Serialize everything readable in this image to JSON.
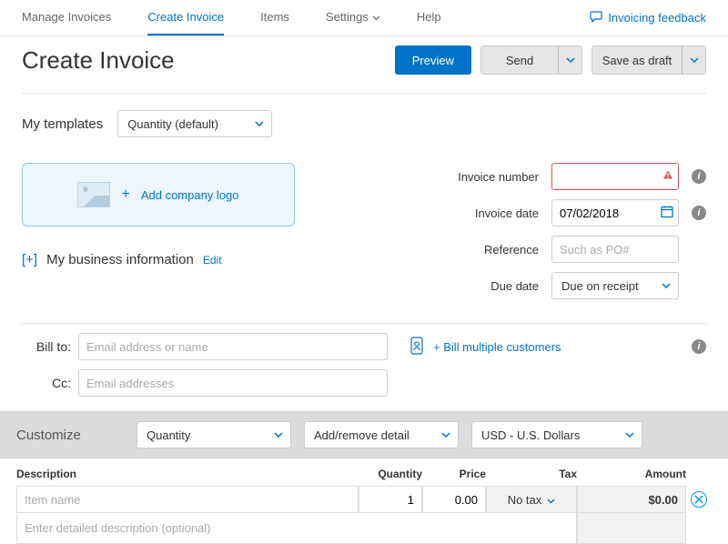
{
  "topnav": {
    "tabs": [
      "Manage Invoices",
      "Create Invoice",
      "Items",
      "Settings",
      "Help"
    ],
    "active_index": 1,
    "feedback_label": "Invoicing feedback"
  },
  "header": {
    "title": "Create Invoice",
    "preview_btn": "Preview",
    "send_btn": "Send",
    "draft_btn": "Save as draft"
  },
  "templates": {
    "label": "My templates",
    "selected": "Quantity (default)"
  },
  "logo": {
    "add_label": "Add company logo"
  },
  "bizinfo": {
    "expand_symbol": "[+]",
    "label": "My business information",
    "edit": "Edit"
  },
  "meta": {
    "invoice_number": {
      "label": "Invoice number",
      "value": ""
    },
    "invoice_date": {
      "label": "Invoice date",
      "value": "07/02/2018"
    },
    "reference": {
      "label": "Reference",
      "placeholder": "Such as PO#"
    },
    "due_date": {
      "label": "Due date",
      "value": "Due on receipt"
    }
  },
  "billto": {
    "label": "Bill to:",
    "placeholder": "Email address or name",
    "cc_label": "Cc:",
    "cc_placeholder": "Email addresses",
    "bill_multiple": "+ Bill multiple customers"
  },
  "customize": {
    "label": "Customize",
    "template_select": "Quantity",
    "detail_select": "Add/remove detail",
    "currency_select": "USD - U.S. Dollars"
  },
  "lineitems": {
    "headers": {
      "desc": "Description",
      "qty": "Quantity",
      "price": "Price",
      "tax": "Tax",
      "amount": "Amount"
    },
    "rows": [
      {
        "name_placeholder": "Item name",
        "qty": "1",
        "price": "0.00",
        "tax": "No tax",
        "amount": "$0.00",
        "desc_placeholder": "Enter detailed description (optional)"
      }
    ]
  }
}
